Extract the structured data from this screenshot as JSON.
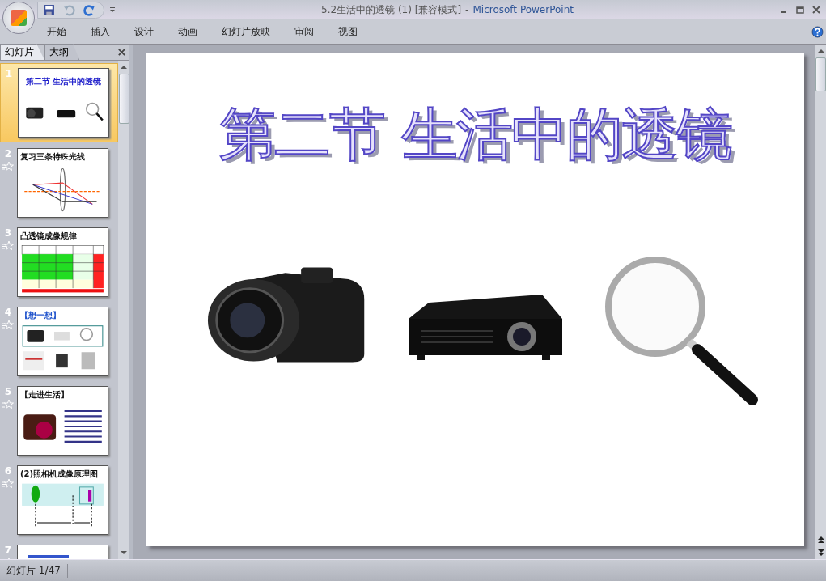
{
  "window": {
    "title": "5.2生活中的透镜 (1) [兼容模式]",
    "separator": "-",
    "app_name": "Microsoft PowerPoint"
  },
  "ribbon_tabs": [
    {
      "label": "开始"
    },
    {
      "label": "插入"
    },
    {
      "label": "设计"
    },
    {
      "label": "动画"
    },
    {
      "label": "幻灯片放映"
    },
    {
      "label": "审阅"
    },
    {
      "label": "视图"
    }
  ],
  "panel_tabs": [
    {
      "label": "幻灯片",
      "selected": true
    },
    {
      "label": "大纲",
      "selected": false
    }
  ],
  "slides": [
    {
      "number": "1",
      "selected": true,
      "animated": false,
      "kind": "title",
      "title": "第二节 生活中的透镜"
    },
    {
      "number": "2",
      "selected": false,
      "animated": true,
      "kind": "rays",
      "title": "复习三条特殊光线"
    },
    {
      "number": "3",
      "selected": false,
      "animated": true,
      "kind": "table",
      "title": "凸透镜成像规律"
    },
    {
      "number": "4",
      "selected": false,
      "animated": true,
      "kind": "images",
      "title": "【想一想】"
    },
    {
      "number": "5",
      "selected": false,
      "animated": true,
      "kind": "camera",
      "title": "【走进生活】"
    },
    {
      "number": "6",
      "selected": false,
      "animated": true,
      "kind": "diagram",
      "title": "(2)照相机成像原理图"
    },
    {
      "number": "7",
      "selected": false,
      "animated": true,
      "kind": "partial"
    }
  ],
  "slide": {
    "title": "第二节 生活中的透镜"
  },
  "status_bar": {
    "slide_indicator": "幻灯片 1/47"
  }
}
